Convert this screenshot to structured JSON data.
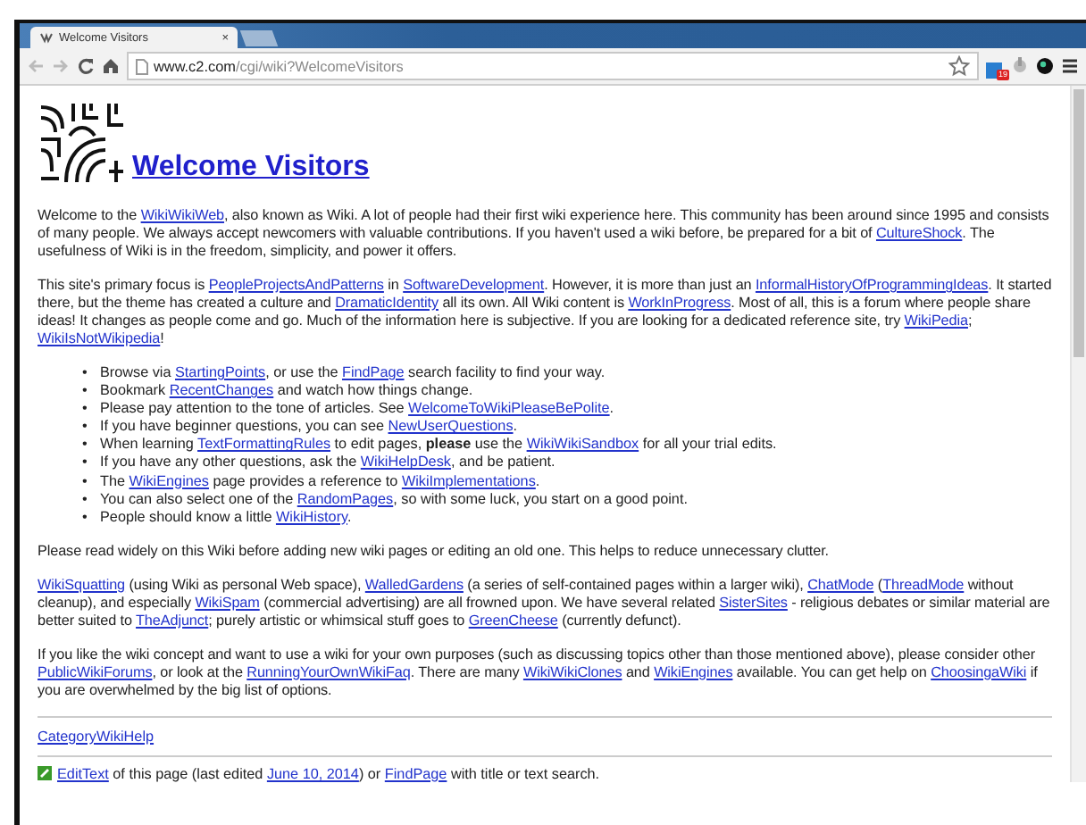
{
  "browser": {
    "tab": {
      "title": "Welcome Visitors",
      "close": "×",
      "selected": true
    },
    "address": {
      "host": "www.c2.com",
      "path": "/cgi/wiki?WelcomeVisitors"
    },
    "badge": "19"
  },
  "page": {
    "title": "Welcome Visitors",
    "paragraphs": [
      [
        {
          "kind": "text",
          "text": "Welcome to the "
        },
        {
          "kind": "link",
          "text": "WikiWikiWeb"
        },
        {
          "kind": "text",
          "text": ", also known as Wiki. A lot of people had their first wiki experience here. This community has been around since 1995 and consists of many people. We always accept newcomers with valuable contributions. If you haven't used a wiki before, be prepared for a bit of "
        },
        {
          "kind": "link",
          "text": "CultureShock"
        },
        {
          "kind": "text",
          "text": ". The usefulness of Wiki is in the freedom, simplicity, and power it offers."
        }
      ],
      [
        {
          "kind": "text",
          "text": "This site's primary focus is "
        },
        {
          "kind": "link",
          "text": "PeopleProjectsAndPatterns"
        },
        {
          "kind": "text",
          "text": " in "
        },
        {
          "kind": "link",
          "text": "SoftwareDevelopment"
        },
        {
          "kind": "text",
          "text": ". However, it is more than just an "
        },
        {
          "kind": "link",
          "text": "InformalHistoryOfProgrammingIdeas"
        },
        {
          "kind": "text",
          "text": ". It started there, but the theme has created a culture and "
        },
        {
          "kind": "link",
          "text": "DramaticIdentity"
        },
        {
          "kind": "text",
          "text": " all its own. All Wiki content is "
        },
        {
          "kind": "link",
          "text": "WorkInProgress"
        },
        {
          "kind": "text",
          "text": ". Most of all, this is a forum where people share ideas! It changes as people come and go. Much of the information here is subjective. If you are looking for a dedicated reference site, try "
        },
        {
          "kind": "link",
          "text": "WikiPedia"
        },
        {
          "kind": "text",
          "text": "; "
        },
        {
          "kind": "link",
          "text": "WikiIsNotWikipedia"
        },
        {
          "kind": "text",
          "text": "!"
        }
      ]
    ],
    "bullet_marker": "•",
    "bullets": [
      [
        {
          "kind": "text",
          "text": "Browse via "
        },
        {
          "kind": "link",
          "text": "StartingPoints"
        },
        {
          "kind": "text",
          "text": ", or use the "
        },
        {
          "kind": "link",
          "text": "FindPage"
        },
        {
          "kind": "text",
          "text": " search facility to find your way."
        }
      ],
      [
        {
          "kind": "text",
          "text": "Bookmark "
        },
        {
          "kind": "link",
          "text": "RecentChanges"
        },
        {
          "kind": "text",
          "text": " and watch how things change."
        }
      ],
      [
        {
          "kind": "text",
          "text": "Please pay attention to the tone of articles. See "
        },
        {
          "kind": "link",
          "text": "WelcomeToWikiPleaseBePolite"
        },
        {
          "kind": "text",
          "text": "."
        }
      ],
      [
        {
          "kind": "text",
          "text": "If you have beginner questions, you can see "
        },
        {
          "kind": "link",
          "text": "NewUserQuestions"
        },
        {
          "kind": "text",
          "text": "."
        }
      ],
      [
        {
          "kind": "text",
          "text": "When learning "
        },
        {
          "kind": "link",
          "text": "TextFormattingRules"
        },
        {
          "kind": "text",
          "text": " to edit pages, "
        },
        {
          "kind": "bold",
          "text": "please"
        },
        {
          "kind": "text",
          "text": " use the "
        },
        {
          "kind": "link",
          "text": "WikiWikiSandbox"
        },
        {
          "kind": "text",
          "text": " for all your trial edits."
        }
      ],
      [
        {
          "kind": "text",
          "text": "If you have any other questions, ask the "
        },
        {
          "kind": "link",
          "text": "WikiHelpDesk"
        },
        {
          "kind": "text",
          "text": ", and be patient."
        }
      ],
      [
        {
          "kind": "text",
          "text": "The "
        },
        {
          "kind": "link",
          "text": "WikiEngines"
        },
        {
          "kind": "text",
          "text": " page provides a reference to "
        },
        {
          "kind": "link",
          "text": "WikiImplementations"
        },
        {
          "kind": "text",
          "text": "."
        }
      ],
      [
        {
          "kind": "text",
          "text": "You can also select one of the "
        },
        {
          "kind": "link",
          "text": "RandomPages"
        },
        {
          "kind": "text",
          "text": ", so with some luck, you start on a good point."
        }
      ],
      [
        {
          "kind": "text",
          "text": "People should know a little "
        },
        {
          "kind": "link",
          "text": "WikiHistory"
        },
        {
          "kind": "text",
          "text": "."
        }
      ]
    ],
    "paragraphs_after": [
      [
        {
          "kind": "text",
          "text": "Please read widely on this Wiki before adding new wiki pages or editing an old one. This helps to reduce unnecessary clutter."
        }
      ],
      [
        {
          "kind": "link",
          "text": "WikiSquatting"
        },
        {
          "kind": "text",
          "text": " (using Wiki as personal Web space), "
        },
        {
          "kind": "link",
          "text": "WalledGardens"
        },
        {
          "kind": "text",
          "text": " (a series of self-contained pages within a larger wiki), "
        },
        {
          "kind": "link",
          "text": "ChatMode"
        },
        {
          "kind": "text",
          "text": " ("
        },
        {
          "kind": "link",
          "text": "ThreadMode"
        },
        {
          "kind": "text",
          "text": " without cleanup), and especially "
        },
        {
          "kind": "link",
          "text": "WikiSpam"
        },
        {
          "kind": "text",
          "text": " (commercial advertising) are all frowned upon. We have several related "
        },
        {
          "kind": "link",
          "text": "SisterSites"
        },
        {
          "kind": "text",
          "text": " - religious debates or similar material are better suited to "
        },
        {
          "kind": "link",
          "text": "TheAdjunct"
        },
        {
          "kind": "text",
          "text": "; purely artistic or whimsical stuff goes to "
        },
        {
          "kind": "link",
          "text": "GreenCheese"
        },
        {
          "kind": "text",
          "text": " (currently defunct)."
        }
      ],
      [
        {
          "kind": "text",
          "text": "If you like the wiki concept and want to use a wiki for your own purposes (such as discussing topics other than those mentioned above), please consider other "
        },
        {
          "kind": "link",
          "text": "PublicWikiForums"
        },
        {
          "kind": "text",
          "text": ", or look at the "
        },
        {
          "kind": "link",
          "text": "RunningYourOwnWikiFaq"
        },
        {
          "kind": "text",
          "text": ". There are many "
        },
        {
          "kind": "link",
          "text": "WikiWikiClones"
        },
        {
          "kind": "text",
          "text": " and "
        },
        {
          "kind": "link",
          "text": "WikiEngines"
        },
        {
          "kind": "text",
          "text": " available. You can get help on "
        },
        {
          "kind": "link",
          "text": "ChoosingaWiki"
        },
        {
          "kind": "text",
          "text": " if you are overwhelmed by the big list of options."
        }
      ]
    ],
    "category": "CategoryWikiHelp",
    "footer": [
      {
        "kind": "link",
        "text": "EditText"
      },
      {
        "kind": "text",
        "text": " of this page (last edited "
      },
      {
        "kind": "link",
        "text": "June 10, 2014"
      },
      {
        "kind": "text",
        "text": ") or "
      },
      {
        "kind": "link",
        "text": "FindPage"
      },
      {
        "kind": "text",
        "text": " with title or text search."
      }
    ]
  }
}
